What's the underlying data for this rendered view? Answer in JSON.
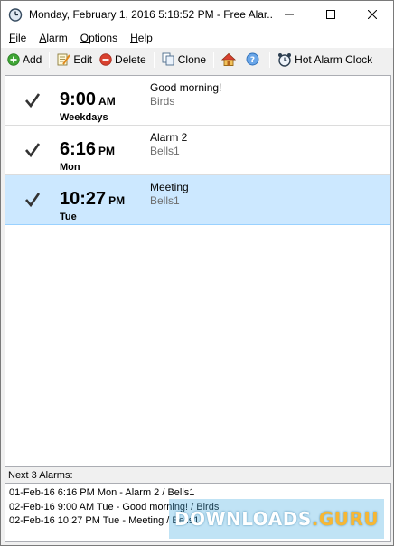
{
  "window": {
    "title": "Monday, February 1, 2016 5:18:52 PM - Free Alar...",
    "controls": {
      "minimize_icon": "minimize-icon",
      "maximize_icon": "maximize-icon",
      "close_icon": "close-icon"
    }
  },
  "menu": {
    "file": {
      "accel": "F",
      "rest": "ile"
    },
    "alarm": {
      "accel": "A",
      "rest": "larm"
    },
    "options": {
      "accel": "O",
      "rest": "ptions"
    },
    "help": {
      "accel": "H",
      "rest": "elp"
    }
  },
  "toolbar": {
    "add_label": "Add",
    "edit_label": "Edit",
    "delete_label": "Delete",
    "clone_label": "Clone",
    "hot_alarm_label": "Hot Alarm Clock"
  },
  "alarms": [
    {
      "time": "9:00",
      "ampm": "AM",
      "days": "Weekdays",
      "name": "Good morning!",
      "sound": "Birds",
      "enabled": true,
      "selected": false
    },
    {
      "time": "6:16",
      "ampm": "PM",
      "days": "Mon",
      "name": "Alarm 2",
      "sound": "Bells1",
      "enabled": true,
      "selected": false
    },
    {
      "time": "10:27",
      "ampm": "PM",
      "days": "Tue",
      "name": "Meeting",
      "sound": "Bells1",
      "enabled": true,
      "selected": true
    }
  ],
  "next_alarms": {
    "label": "Next 3 Alarms:",
    "items": [
      {
        "main": "01-Feb-16 6:16 PM Mon - Alarm 2 / Bells1"
      },
      {
        "main": "02-Feb-16 9:00 AM Tue - Good morning! / Birds"
      },
      {
        "main": "02-Feb-16 10:27 PM Tue - Meeting / Bells1"
      }
    ]
  },
  "watermark": {
    "text_a": "DOWNLOADS",
    "text_b": ".GURU"
  },
  "colors": {
    "selection": "#cce8ff",
    "border": "#abadb3",
    "add_green": "#3fa535",
    "delete_red": "#d9412f"
  }
}
